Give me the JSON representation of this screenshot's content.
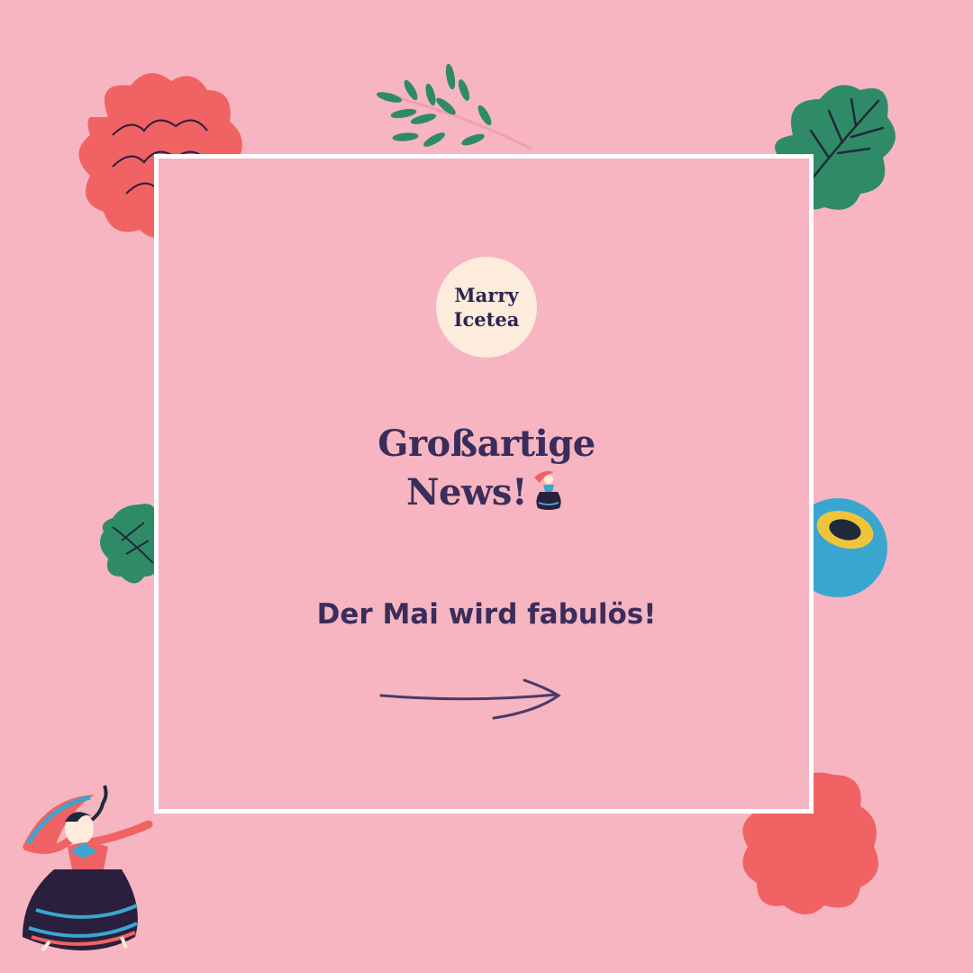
{
  "brand": {
    "logo_line1": "Marry",
    "logo_line2": "Icetea",
    "colors": {
      "background": "#f6b5c0",
      "text": "#3a2d5c",
      "logo_bg": "#fdebdc",
      "frame": "#ffffff"
    }
  },
  "post": {
    "headline_line1": "Großartige",
    "headline_line2": "News!",
    "subtitle": "Der Mai wird fabulös!"
  },
  "decorations": {
    "icons": [
      "raspberry-icon",
      "leafy-branch-icon",
      "green-leaf-icon",
      "small-green-leaf-icon",
      "blue-lime-icon",
      "raspberry-icon",
      "dancing-woman-icon",
      "arrow-right-icon"
    ]
  }
}
